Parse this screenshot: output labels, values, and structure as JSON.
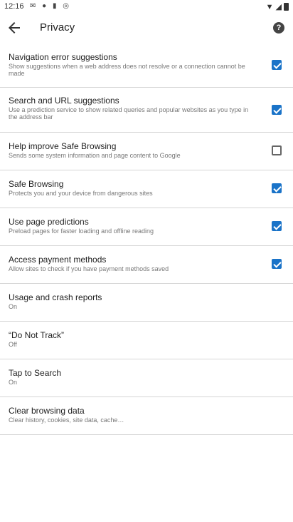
{
  "status_bar": {
    "time": "12:16"
  },
  "app_bar": {
    "title": "Privacy"
  },
  "settings": [
    {
      "title": "Navigation error suggestions",
      "summary": "Show suggestions when a web address does not resolve or a connection cannot be made",
      "checked": true
    },
    {
      "title": "Search and URL suggestions",
      "summary": "Use a prediction service to show related queries and popular websites as you type in the address bar",
      "checked": true
    },
    {
      "title": "Help improve Safe Browsing",
      "summary": "Sends some system information and page content to Google",
      "checked": false
    },
    {
      "title": "Safe Browsing",
      "summary": "Protects you and your device from dangerous sites",
      "checked": true
    },
    {
      "title": "Use page predictions",
      "summary": "Preload pages for faster loading and offline reading",
      "checked": true
    },
    {
      "title": "Access payment methods",
      "summary": "Allow sites to check if you have payment methods saved",
      "checked": true
    },
    {
      "title": "Usage and crash reports",
      "summary": "On"
    },
    {
      "title": "“Do Not Track”",
      "summary": "Off"
    },
    {
      "title": "Tap to Search",
      "summary": "On"
    },
    {
      "title": "Clear browsing data",
      "summary": "Clear history, cookies, site data, cache…"
    }
  ]
}
